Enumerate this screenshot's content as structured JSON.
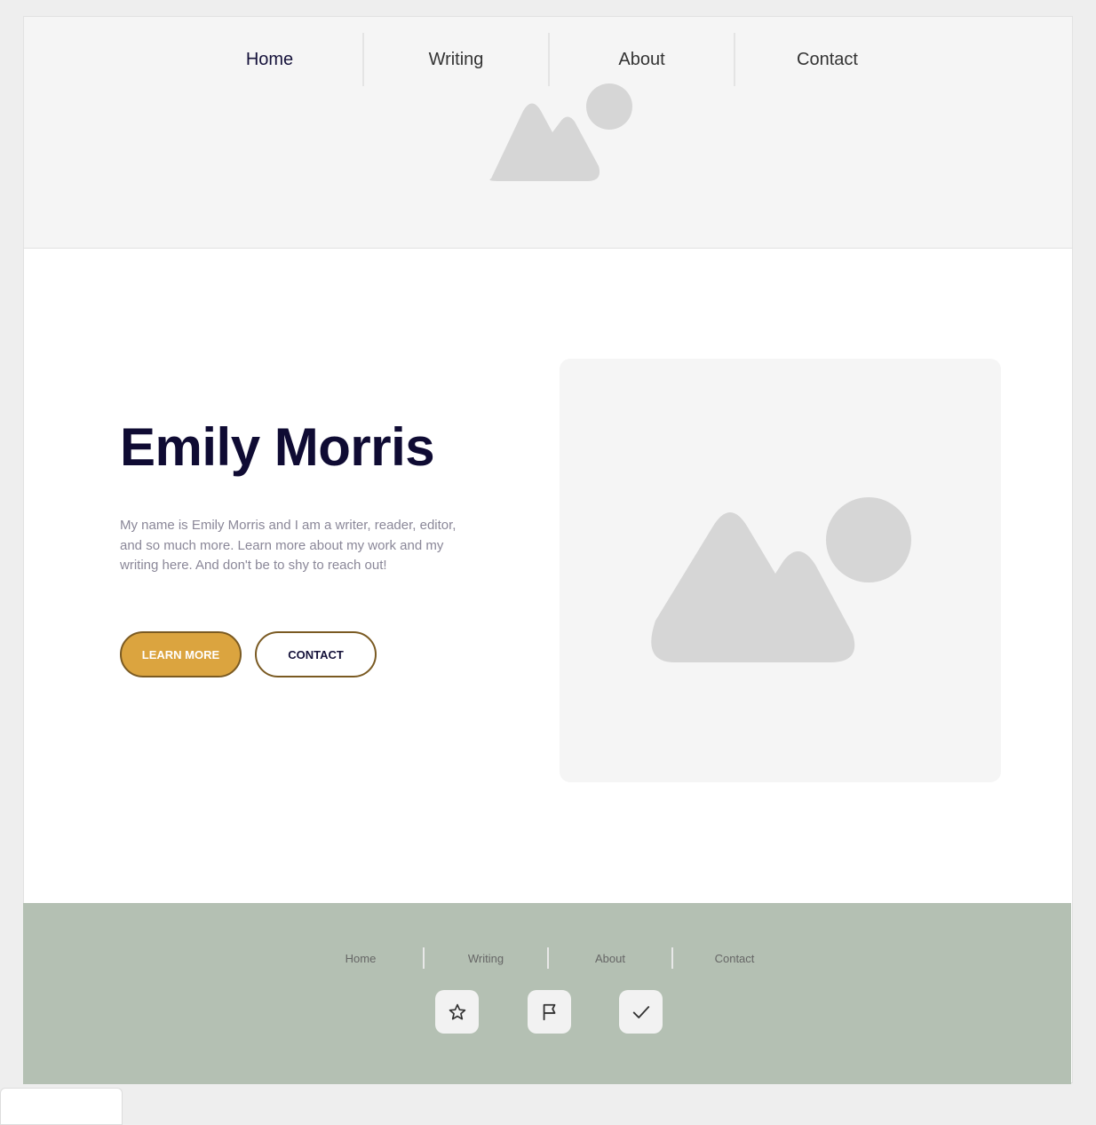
{
  "nav": {
    "items": [
      {
        "label": "Home"
      },
      {
        "label": "Writing"
      },
      {
        "label": "About"
      },
      {
        "label": "Contact"
      }
    ]
  },
  "hero": {
    "title": "Emily Morris",
    "description": "My name is Emily Morris and I am a writer, reader, editor, and so much more. Learn more about my work and my writing here. And don't be to shy to reach out!",
    "primary_button": "LEARN MORE",
    "secondary_button": "CONTACT"
  },
  "footer": {
    "links": [
      {
        "label": "Home"
      },
      {
        "label": "Writing"
      },
      {
        "label": "About"
      },
      {
        "label": "Contact"
      }
    ],
    "icons": [
      "star-icon",
      "flag-icon",
      "check-icon"
    ]
  },
  "colors": {
    "accent": "#dba43f",
    "title": "#0f0b33",
    "footer_bg": "#b4c0b3",
    "header_bg": "#f5f5f5",
    "placeholder": "#d6d6d6"
  }
}
